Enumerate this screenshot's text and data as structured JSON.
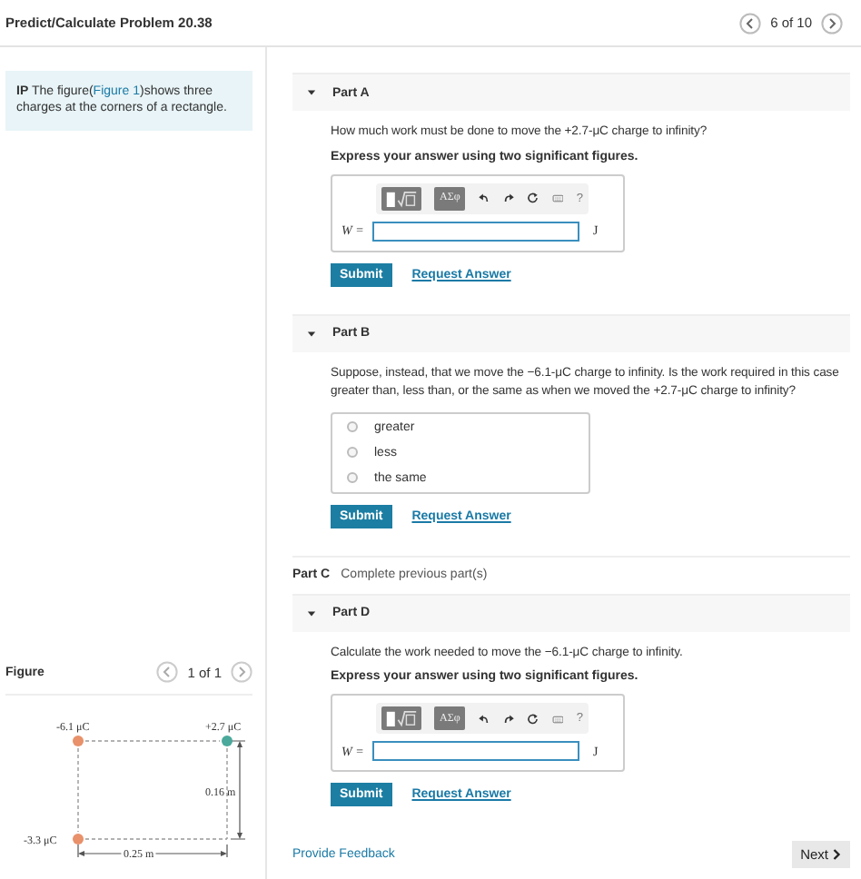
{
  "header": {
    "title": "Predict/Calculate Problem 20.38",
    "pager": "6 of 10"
  },
  "intro": {
    "prefix": "IP",
    "before": " The figure(",
    "link": "Figure 1",
    "after": ")shows three charges at the corners of a rectangle."
  },
  "figure": {
    "title": "Figure",
    "pager": "1 of 1",
    "charges": [
      {
        "label": "-6.1 μC",
        "color": "#e8916a"
      },
      {
        "label": "+2.7 μC",
        "color": "#4aa99b"
      },
      {
        "label": "-3.3 μC",
        "color": "#e8916a"
      }
    ],
    "height_label": "0.16 m",
    "width_label": "0.25 m"
  },
  "parts": [
    {
      "kind": "answer",
      "title": "Part A",
      "question": "How much work must be done to move the +2.7-μC charge to infinity?",
      "instruction": "Express your answer using two significant figures.",
      "symbols": "ΑΣφ",
      "help": "?",
      "variable": "W =",
      "unit": "J",
      "submit": "Submit",
      "request": "Request Answer"
    },
    {
      "kind": "choice",
      "title": "Part B",
      "question": "Suppose, instead, that we move the −6.1-μC charge to infinity. Is the work required in this case greater than, less than, or the same as when we moved the +2.7-μC charge to infinity?",
      "options": [
        {
          "label": "greater",
          "selected": false
        },
        {
          "label": "less",
          "selected": false
        },
        {
          "label": "the same",
          "selected": false
        }
      ],
      "submit": "Submit",
      "request": "Request Answer"
    },
    {
      "kind": "locked",
      "title": "Part C",
      "note": "Complete previous part(s)"
    },
    {
      "kind": "answer",
      "title": "Part D",
      "question": "Calculate the work needed to move the −6.1-μC charge to infinity.",
      "instruction": "Express your answer using two significant figures.",
      "symbols": "ΑΣφ",
      "help": "?",
      "variable": "W =",
      "unit": "J",
      "submit": "Submit",
      "request": "Request Answer"
    }
  ],
  "footer": {
    "feedback": "Provide Feedback",
    "next": "Next"
  }
}
